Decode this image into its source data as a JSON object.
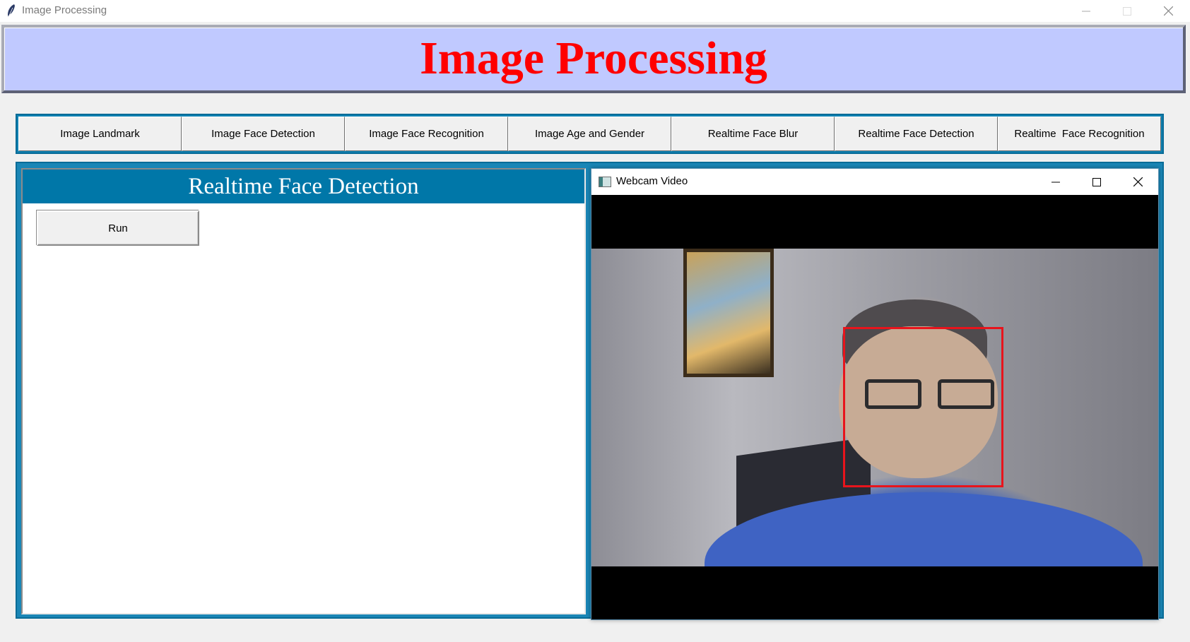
{
  "window": {
    "title": "Image Processing"
  },
  "banner": {
    "title": "Image Processing"
  },
  "tabs": [
    {
      "label": "Image Landmark"
    },
    {
      "label": "Image Face Detection"
    },
    {
      "label": "Image Face Recognition"
    },
    {
      "label": "Image Age and Gender"
    },
    {
      "label": "Realtime Face Blur"
    },
    {
      "label": "Realtime Face Detection"
    },
    {
      "label": "Realtime  Face Recognition"
    }
  ],
  "panel": {
    "title": "Realtime Face Detection",
    "run_label": "Run"
  },
  "webcam": {
    "title": "Webcam Video"
  },
  "colors": {
    "banner_bg": "#c0c9ff",
    "banner_text": "#ff0000",
    "accent": "#0077a8",
    "detection_box": "#e8141c"
  }
}
